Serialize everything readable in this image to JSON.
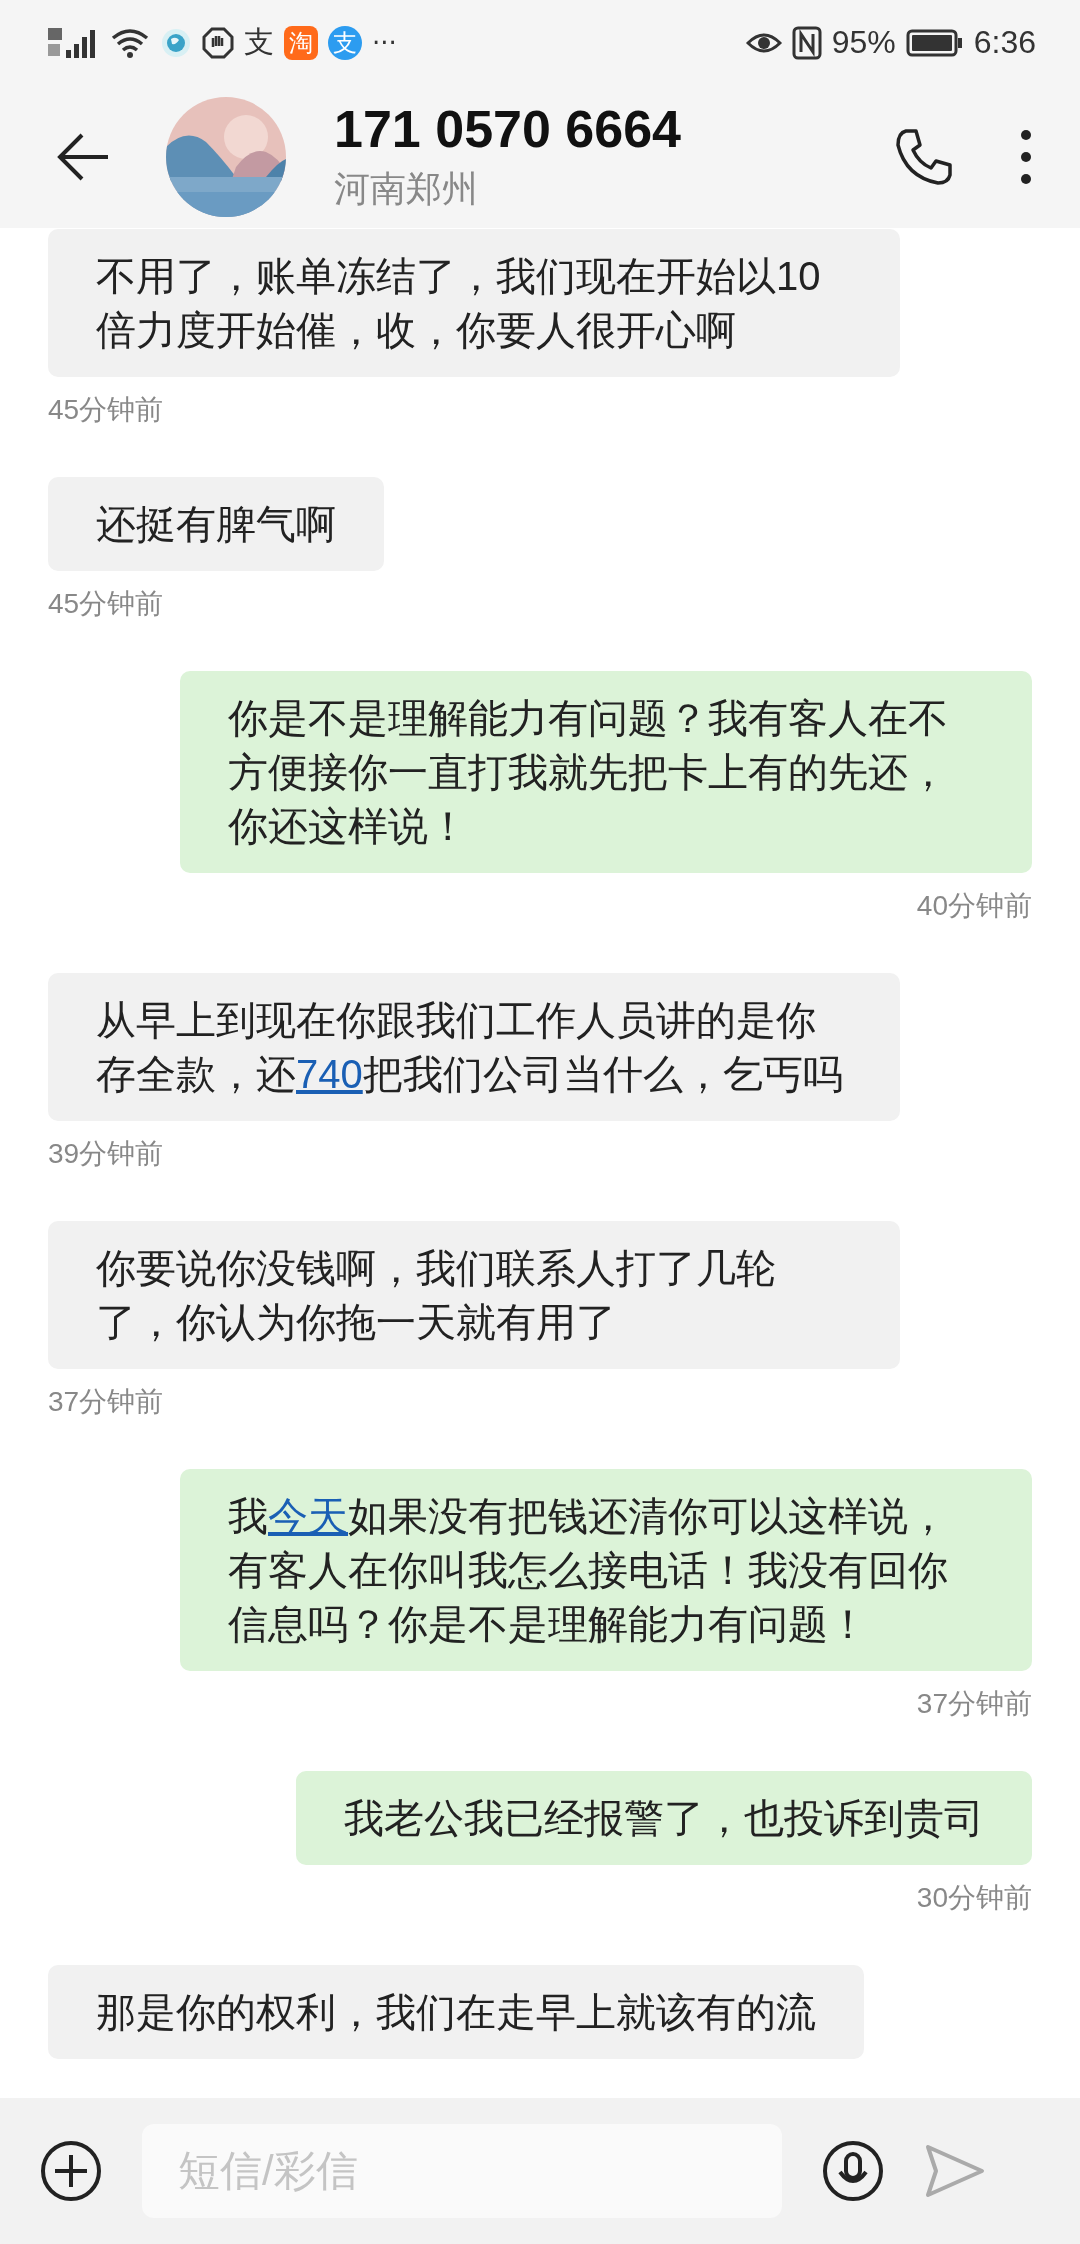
{
  "status_bar": {
    "glyphs": [
      "支",
      "淘",
      "支"
    ],
    "more": "···",
    "battery": "95%",
    "time": "6:36"
  },
  "header": {
    "name": "171 0570 6664",
    "location": "河南郑州"
  },
  "messages": [
    {
      "kind": "received",
      "segments": [
        {
          "text": "不用了，账单冻结了，我们现在开始以10倍力度开始催，收，你要人很开心啊",
          "link": false
        }
      ],
      "time": "45分钟前"
    },
    {
      "kind": "received",
      "segments": [
        {
          "text": "还挺有脾气啊",
          "link": false
        }
      ],
      "time": "45分钟前"
    },
    {
      "kind": "sent",
      "segments": [
        {
          "text": "你是不是理解能力有问题？我有客人在不方便接你一直打我就先把卡上有的先还，你还这样说！",
          "link": false
        }
      ],
      "time": "40分钟前"
    },
    {
      "kind": "received",
      "segments": [
        {
          "text": "从早上到现在你跟我们工作人员讲的是你存全款，还",
          "link": false
        },
        {
          "text": "740",
          "link": true
        },
        {
          "text": "把我们公司当什么，乞丐吗",
          "link": false
        }
      ],
      "time": "39分钟前"
    },
    {
      "kind": "received",
      "segments": [
        {
          "text": "你要说你没钱啊，我们联系人打了几轮了，你认为你拖一天就有用了",
          "link": false
        }
      ],
      "time": "37分钟前"
    },
    {
      "kind": "sent",
      "segments": [
        {
          "text": "我",
          "link": false
        },
        {
          "text": "今天",
          "link": true
        },
        {
          "text": "如果没有把钱还清你可以这样说，有客人在你叫我怎么接电话！我没有回你信息吗？你是不是理解能力有问题！",
          "link": false
        }
      ],
      "time": "37分钟前"
    },
    {
      "kind": "sent",
      "segments": [
        {
          "text": "我老公我已经报警了，也投诉到贵司",
          "link": false
        }
      ],
      "time": "30分钟前"
    },
    {
      "kind": "received",
      "segments": [
        {
          "text": "那是你的权利，我们在走早上就该有的流",
          "link": false
        }
      ]
    }
  ],
  "composer": {
    "placeholder": "短信/彩信"
  }
}
